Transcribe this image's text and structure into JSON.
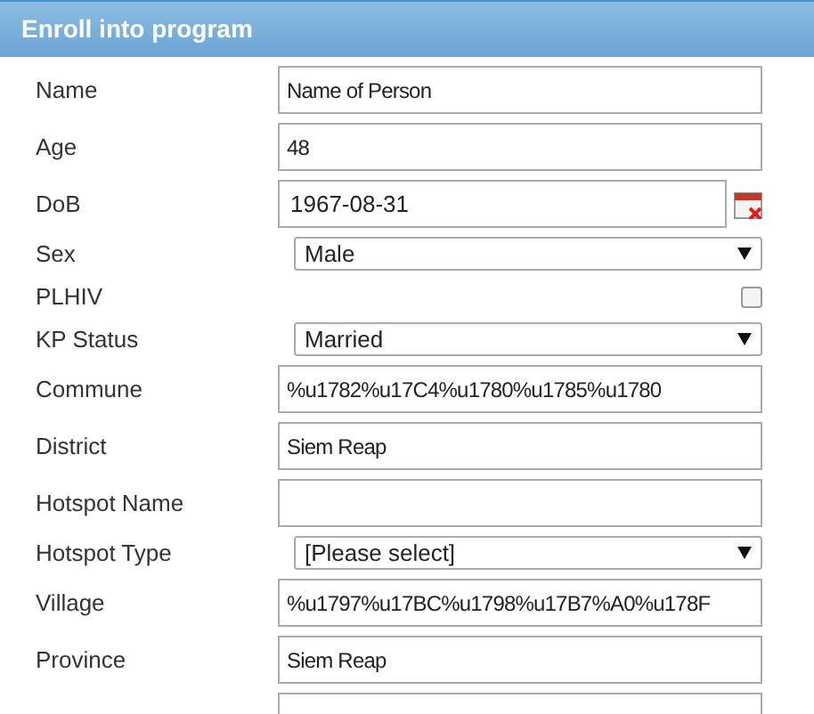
{
  "header": {
    "title": "Enroll into program"
  },
  "fields": [
    {
      "kind": "text",
      "label": "Name",
      "value": "Name of Person"
    },
    {
      "kind": "text",
      "label": "Age",
      "value": "48"
    },
    {
      "kind": "date",
      "label": "DoB",
      "value": "1967-08-31"
    },
    {
      "kind": "select",
      "label": "Sex",
      "value": "Male"
    },
    {
      "kind": "checkbox",
      "label": "PLHIV",
      "checked": false
    },
    {
      "kind": "select",
      "label": "KP Status",
      "value": "Married"
    },
    {
      "kind": "text",
      "label": "Commune",
      "value": "%u1782%u17C4%u1780%u1785%u1780"
    },
    {
      "kind": "text",
      "label": "District",
      "value": "Siem Reap"
    },
    {
      "kind": "text",
      "label": "Hotspot Name"
    },
    {
      "kind": "select",
      "label": "Hotspot Type",
      "value": "[Please select]"
    },
    {
      "kind": "text",
      "label": "Village",
      "value": "%u1797%u17BC%u1798%u17B7%A0%u178F"
    },
    {
      "kind": "text",
      "label": "Province",
      "value": "Siem Reap"
    },
    {
      "kind": "text"
    }
  ]
}
